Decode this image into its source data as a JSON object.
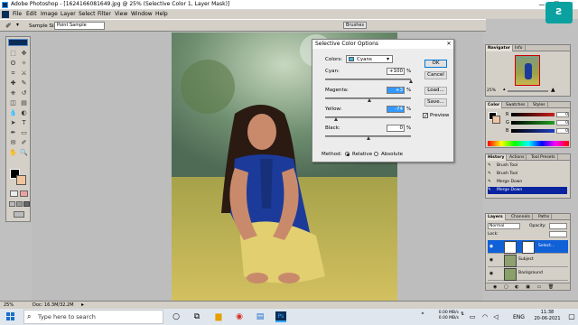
{
  "window": {
    "title": "Adobe Photoshop - [1624166081649.jpg @ 25% (Selective Color 1, Layer Mask)]",
    "controls": {
      "minimize": "—",
      "restore": "❐",
      "close": "✕"
    }
  },
  "menu": [
    "File",
    "Edit",
    "Image",
    "Layer",
    "Select",
    "Filter",
    "View",
    "Window",
    "Help"
  ],
  "options_bar": {
    "sample_size_label": "Sample Size:",
    "sample_size_value": "Point Sample"
  },
  "brushes_tab": "Brushes",
  "toolbox": {
    "icons": [
      "marquee-icon",
      "move-icon",
      "lasso-icon",
      "magic-wand-icon",
      "crop-icon",
      "slice-icon",
      "healing-icon",
      "brush-icon",
      "stamp-icon",
      "history-brush-icon",
      "eraser-icon",
      "gradient-icon",
      "blur-icon",
      "dodge-icon",
      "path-select-icon",
      "type-icon",
      "pen-icon",
      "shape-icon",
      "notes-icon",
      "eyedropper-icon",
      "hand-icon",
      "zoom-icon"
    ],
    "glyphs": [
      "⬚",
      "✥",
      "ʘ",
      "✧",
      "⌗",
      "⚔",
      "✚",
      "✎",
      "⎈",
      "↺",
      "◫",
      "▤",
      "💧",
      "◐",
      "➤",
      "T",
      "✒",
      "▭",
      "✉",
      "✐",
      "✋",
      "🔍"
    ],
    "foreground_color": "#000000",
    "background_color": "#f1c4a0"
  },
  "dialog": {
    "title": "Selective Color Options",
    "close": "✕",
    "colors_label": "Colors:",
    "colors_value": "Cyans",
    "sliders": [
      {
        "label": "Cyan:",
        "value": "+100",
        "unit": "%",
        "position": 1.0
      },
      {
        "label": "Magenta:",
        "value": "+3",
        "unit": "%",
        "position": 0.52
      },
      {
        "label": "Yellow:",
        "value": "-74",
        "unit": "%",
        "position": 0.13
      },
      {
        "label": "Black:",
        "value": "0",
        "unit": "%",
        "position": 0.5
      }
    ],
    "buttons": [
      "OK",
      "Cancel",
      "Load...",
      "Save..."
    ],
    "preview_label": "Preview",
    "preview_checked": true,
    "method_label": "Method:",
    "method_relative": "Relative",
    "method_absolute": "Absolute",
    "method_selected": "Relative"
  },
  "navigator": {
    "tabs": [
      "Navigator",
      "Info"
    ],
    "zoom": "25%"
  },
  "color_panel": {
    "tabs": [
      "Color",
      "Swatches",
      "Styles"
    ],
    "channels": [
      {
        "label": "R",
        "value": "0",
        "color": "#cc2020"
      },
      {
        "label": "G",
        "value": "0",
        "color": "#20a020"
      },
      {
        "label": "B",
        "value": "0",
        "color": "#2040c0"
      }
    ]
  },
  "history": {
    "tabs": [
      "History",
      "Actions",
      "Tool Presets"
    ],
    "items": [
      "Brush Tool",
      "Brush Tool",
      "Merge Down",
      "Merge Down"
    ],
    "selected_index": 3
  },
  "layers": {
    "tabs": [
      "Layers",
      "Channels",
      "Paths"
    ],
    "blend_mode": "Normal",
    "opacity_label": "Opacity:",
    "lock_label": "Lock:",
    "rows": [
      {
        "name": "Select...",
        "selected": true
      },
      {
        "name": "Subject",
        "selected": false
      },
      {
        "name": "Background",
        "selected": false
      }
    ]
  },
  "status": {
    "zoom": "25%",
    "doc": "Doc: 16.3M/32.2M"
  },
  "taskbar": {
    "search_placeholder": "Type here to search",
    "net_up": "0.00 MB/s",
    "net_down": "0.00 MB/s",
    "lang": "ENG",
    "time": "11:38",
    "date": "20-06-2021"
  }
}
